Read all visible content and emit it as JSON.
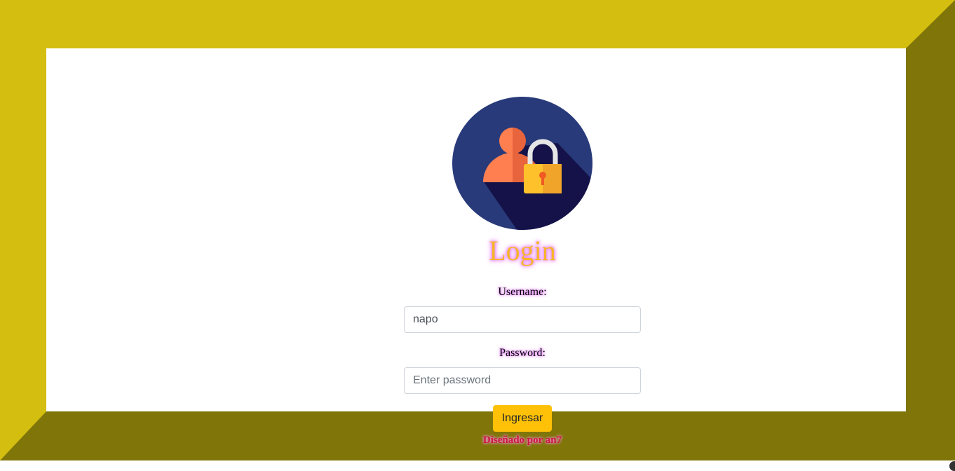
{
  "login": {
    "title": "Login",
    "username_label": "Username:",
    "username_value": "napo",
    "password_label": "Password:",
    "password_placeholder": "Enter password",
    "submit_label": "Ingresar",
    "credit": "Diseñado por an7"
  },
  "icons": {
    "avatar": "user-lock-icon"
  },
  "colors": {
    "frame_light": "#d4bf10",
    "frame_dark": "#807509",
    "button": "#ffc107",
    "title": "#f7b52b",
    "credit": "#c9183c",
    "avatar_bg": "#283a79"
  }
}
